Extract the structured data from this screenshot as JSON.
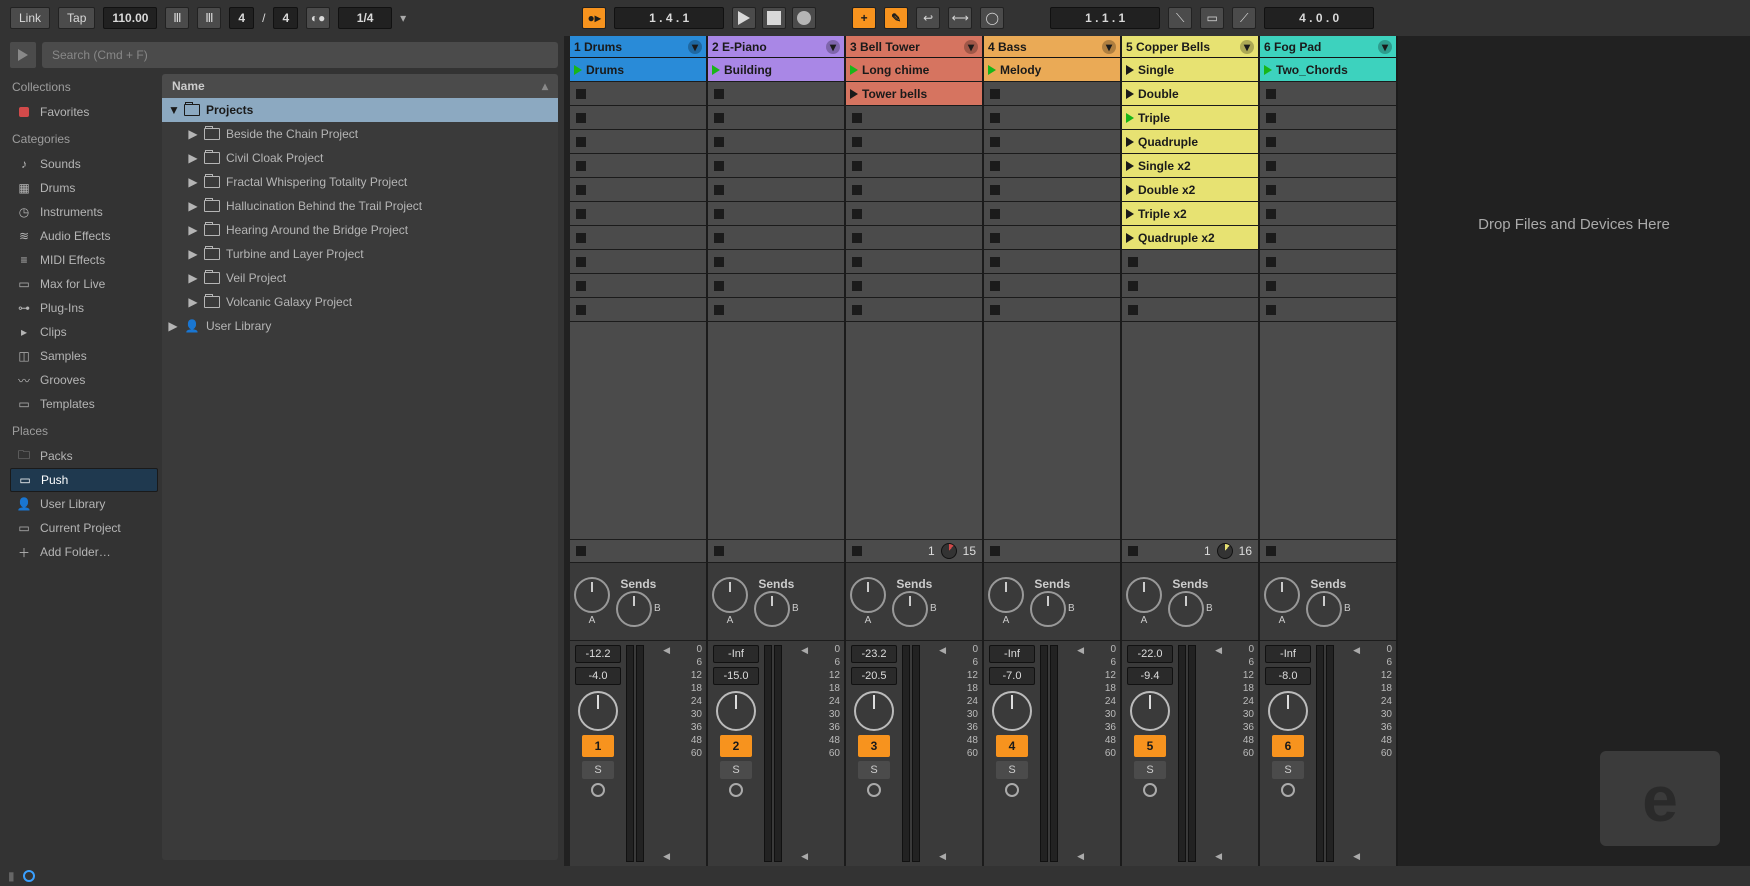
{
  "top": {
    "link": "Link",
    "tap": "Tap",
    "tempo": "110.00",
    "sig_num": "4",
    "sig_sep": "/",
    "sig_den": "4",
    "quant": "1/4",
    "pos1": "1 .   4 .   1",
    "pos2": "1 .   1 .   1",
    "pos3": "4 .   0 .   0",
    "plus": "+",
    "pencil": "✎"
  },
  "search": {
    "placeholder": "Search (Cmd + F)"
  },
  "collections": {
    "header": "Collections",
    "items": [
      {
        "label": "Favorites"
      }
    ]
  },
  "categories": {
    "header": "Categories",
    "items": [
      {
        "label": "Sounds",
        "icon": "♪"
      },
      {
        "label": "Drums",
        "icon": "▦"
      },
      {
        "label": "Instruments",
        "icon": "◷"
      },
      {
        "label": "Audio Effects",
        "icon": "≋"
      },
      {
        "label": "MIDI Effects",
        "icon": "≡"
      },
      {
        "label": "Max for Live",
        "icon": "▭"
      },
      {
        "label": "Plug-Ins",
        "icon": "⊶"
      },
      {
        "label": "Clips",
        "icon": "▸"
      },
      {
        "label": "Samples",
        "icon": "◫"
      },
      {
        "label": "Grooves",
        "icon": "〰"
      },
      {
        "label": "Templates",
        "icon": "▭"
      }
    ]
  },
  "places": {
    "header": "Places",
    "items": [
      {
        "label": "Packs",
        "icon": "🗀",
        "sel": false
      },
      {
        "label": "Push",
        "icon": "▭",
        "sel": true
      },
      {
        "label": "User Library",
        "icon": "👤",
        "sel": false
      },
      {
        "label": "Current Project",
        "icon": "▭",
        "sel": false
      },
      {
        "label": "Add Folder…",
        "icon": "＋",
        "sel": false
      }
    ]
  },
  "files": {
    "header": "Name",
    "root": "Projects",
    "items": [
      "Beside the Chain Project",
      "Civil Cloak Project",
      "Fractal Whispering Totality Project",
      "Hallucination Behind the Trail Project",
      "Hearing Around the Bridge Project",
      "Turbine and Layer Project",
      "Veil Project",
      "Volcanic Galaxy Project"
    ],
    "user_lib": "User Library"
  },
  "dropzone": "Drop Files and Devices Here",
  "tracks": [
    {
      "title": "1 Drums",
      "color": "#298bd8",
      "clips": [
        {
          "name": "Drums",
          "color": "#298bd8",
          "play": true
        }
      ],
      "vol": "-12.2",
      "trim": "-4.0",
      "num": "1"
    },
    {
      "title": "2 E-Piano",
      "color": "#a987e6",
      "clips": [
        {
          "name": "Building",
          "color": "#a987e6",
          "play": true
        }
      ],
      "vol": "-Inf",
      "trim": "-15.0",
      "num": "2"
    },
    {
      "title": "3 Bell Tower",
      "color": "#d67460",
      "clips": [
        {
          "name": "Long chime",
          "color": "#d67460",
          "play": true
        },
        {
          "name": "Tower bells",
          "color": "#d67460",
          "play": false
        }
      ],
      "dev": {
        "n": "1",
        "pie": "#d24a4a",
        "v": "15"
      },
      "vol": "-23.2",
      "trim": "-20.5",
      "num": "3"
    },
    {
      "title": "4 Bass",
      "color": "#eaaa56",
      "clips": [
        {
          "name": "Melody",
          "color": "#eaaa56",
          "play": true
        }
      ],
      "vol": "-Inf",
      "trim": "-7.0",
      "num": "4"
    },
    {
      "title": "5 Copper Bells",
      "color": "#e7e272",
      "clips": [
        {
          "name": "Single",
          "color": "#e7e272",
          "play": false
        },
        {
          "name": "Double",
          "color": "#e7e272",
          "play": false
        },
        {
          "name": "Triple",
          "color": "#e7e272",
          "play": true
        },
        {
          "name": "Quadruple",
          "color": "#e7e272",
          "play": false
        },
        {
          "name": "Single x2",
          "color": "#e7e272",
          "play": false
        },
        {
          "name": "Double x2",
          "color": "#e7e272",
          "play": false
        },
        {
          "name": "Triple x2",
          "color": "#e7e272",
          "play": false
        },
        {
          "name": "Quadruple x2",
          "color": "#e7e272",
          "play": false
        }
      ],
      "dev": {
        "n": "1",
        "pie": "#e7e272",
        "v": "16"
      },
      "vol": "-22.0",
      "trim": "-9.4",
      "num": "5"
    },
    {
      "title": "6 Fog Pad",
      "color": "#3dd2be",
      "clips": [
        {
          "name": "Two_Chords",
          "color": "#3dd2be",
          "play": true
        }
      ],
      "vol": "-Inf",
      "trim": "-8.0",
      "num": "6"
    }
  ],
  "mixer": {
    "sends": "Sends",
    "A": "A",
    "B": "B",
    "S": "S",
    "scale": [
      "0",
      "6",
      "12",
      "18",
      "24",
      "30",
      "36",
      "48",
      "60"
    ]
  }
}
